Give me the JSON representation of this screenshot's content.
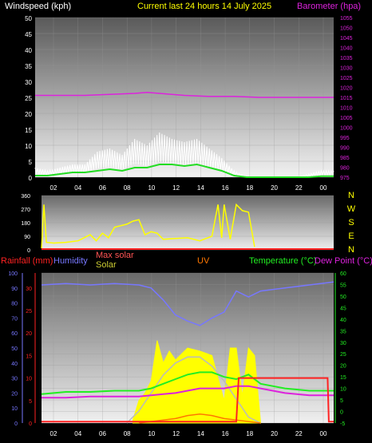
{
  "header": {
    "windspeed_label": "Windspeed (kph)",
    "title": "Current last 24 hours 14 July 2025",
    "barometer_label": "Barometer (hpa)"
  },
  "labels": {
    "rainfall": "Rainfall (mm)",
    "humidity": "Humidity",
    "max_solar": "Max solar",
    "solar": "Solar",
    "uv": "UV",
    "temperature": "Temperature (°C)",
    "dew_point": "Dew Point (°C)"
  },
  "colors": {
    "wind": "#ffffff",
    "wind_avg": "#22dd22",
    "barometer": "#dd22dd",
    "direction": "#ffff00",
    "rainfall": "#ff2222",
    "humidity": "#7777ff",
    "max_solar": "#ff5555",
    "solar": "#ffff00",
    "uv": "#ff7700",
    "temperature": "#22ee22",
    "dew_point": "#dd22dd"
  },
  "chart_data": [
    {
      "type": "line",
      "x_ticks": [
        "02",
        "04",
        "06",
        "08",
        "10",
        "12",
        "14",
        "16",
        "18",
        "20",
        "22",
        "00"
      ],
      "y_left_ticks": [
        0,
        5,
        10,
        15,
        20,
        25,
        30,
        35,
        40,
        45,
        50
      ],
      "y_right_ticks": [
        975,
        980,
        985,
        990,
        995,
        1000,
        1005,
        1010,
        1015,
        1020,
        1025,
        1030,
        1035,
        1040,
        1045,
        1050,
        1055
      ],
      "ylim_left": [
        0,
        50
      ],
      "ylim_right": [
        975,
        1055
      ],
      "series": [
        {
          "name": "Windspeed (kph)",
          "x": [
            0,
            1,
            2,
            3,
            4,
            5,
            6,
            7,
            8,
            9,
            10,
            11,
            12,
            13,
            14,
            15,
            16,
            17,
            18,
            19,
            20,
            21,
            22,
            23,
            24
          ],
          "values": [
            3,
            2,
            3,
            4,
            4,
            8,
            9,
            7,
            12,
            10,
            14,
            12,
            11,
            12,
            9,
            6,
            2,
            0,
            0,
            0,
            0,
            0,
            1,
            2,
            2
          ]
        },
        {
          "name": "Average wind",
          "x": [
            0,
            1,
            2,
            3,
            4,
            5,
            6,
            7,
            8,
            9,
            10,
            11,
            12,
            13,
            14,
            15,
            16,
            17,
            18,
            19,
            20,
            21,
            22,
            23,
            24
          ],
          "values": [
            0.5,
            0.5,
            1,
            1.5,
            1.5,
            2,
            2.5,
            2,
            3,
            3,
            4,
            4,
            3.5,
            4,
            3,
            2,
            0.5,
            0,
            0,
            0,
            0,
            0,
            0,
            0.3,
            0.3
          ]
        },
        {
          "name": "Barometer (hpa)",
          "x": [
            0,
            2,
            4,
            6,
            8,
            9,
            10,
            11,
            12,
            14,
            16,
            18,
            20,
            22,
            24
          ],
          "values": [
            1016,
            1016,
            1016,
            1016.5,
            1017,
            1017.5,
            1017,
            1016.5,
            1016,
            1015.5,
            1015.5,
            1015,
            1015,
            1015,
            1015
          ]
        }
      ]
    },
    {
      "type": "scatter",
      "y_ticks": [
        0,
        90,
        180,
        270,
        360
      ],
      "ylim": [
        0,
        360
      ],
      "compass": [
        "N",
        "W",
        "S",
        "E",
        "N"
      ],
      "series": [
        {
          "name": "Wind direction",
          "x": [
            0,
            0.2,
            0.4,
            1,
            2,
            3,
            4,
            4.5,
            5,
            5.5,
            6,
            6.5,
            7,
            7.5,
            8,
            8.5,
            9,
            9.5,
            10,
            11,
            12,
            13,
            14,
            14.5,
            14.8,
            15,
            15.5,
            16,
            16.5,
            17,
            17.5
          ],
          "values": [
            10,
            300,
            50,
            45,
            50,
            60,
            100,
            60,
            110,
            80,
            150,
            160,
            170,
            190,
            200,
            100,
            120,
            110,
            70,
            75,
            80,
            60,
            90,
            300,
            80,
            300,
            70,
            300,
            260,
            250,
            20
          ]
        }
      ]
    },
    {
      "type": "area",
      "y_left_ticks": [
        0,
        5,
        10,
        15,
        20,
        25,
        30,
        35,
        40,
        45,
        50,
        55,
        60,
        65,
        70,
        75,
        80,
        85,
        90,
        95,
        100
      ],
      "y_right_ticks": [
        -5,
        0,
        5,
        10,
        15,
        20,
        25,
        30,
        35,
        40,
        45,
        50,
        55,
        60
      ],
      "y_rain_ticks": [
        0,
        5,
        10,
        15,
        20,
        25,
        30
      ],
      "ylim_left": [
        0,
        100
      ],
      "ylim_right": [
        -5,
        60
      ],
      "series": [
        {
          "name": "Humidity",
          "x": [
            0,
            2,
            4,
            6,
            8,
            9,
            10,
            11,
            12,
            13,
            14,
            15,
            16,
            17,
            18,
            20,
            22,
            24
          ],
          "values": [
            92,
            93,
            92,
            93,
            92,
            90,
            82,
            72,
            68,
            65,
            70,
            74,
            88,
            84,
            88,
            90,
            92,
            94
          ]
        },
        {
          "name": "Temperature (°C)",
          "x": [
            0,
            2,
            4,
            6,
            8,
            9,
            10,
            11,
            12,
            13,
            14,
            15,
            16,
            17,
            18,
            20,
            22,
            24
          ],
          "values": [
            7.5,
            8.5,
            8.5,
            9,
            9,
            10,
            12,
            14,
            16,
            17,
            17,
            15,
            14,
            16,
            12,
            10,
            9,
            9
          ]
        },
        {
          "name": "Dew Point (°C)",
          "x": [
            0,
            2,
            4,
            6,
            8,
            9,
            10,
            11,
            12,
            13,
            14,
            15,
            16,
            17,
            18,
            20,
            22,
            24
          ],
          "values": [
            6,
            6,
            6.5,
            6.5,
            6.5,
            7,
            7.5,
            8,
            9,
            10,
            10,
            10,
            11,
            11,
            10,
            8,
            7,
            7
          ]
        },
        {
          "name": "Max solar",
          "x": [
            7,
            8,
            9,
            10,
            11,
            12,
            13,
            14,
            15,
            16,
            17,
            18
          ],
          "values": [
            0,
            8,
            20,
            32,
            40,
            44,
            44,
            38,
            28,
            16,
            4,
            0
          ]
        },
        {
          "name": "Solar",
          "x": [
            7.5,
            8,
            8.5,
            9,
            9.5,
            10,
            10.5,
            11,
            12,
            13,
            14,
            15,
            15.5,
            16,
            16.5,
            17,
            17.5,
            18
          ],
          "values": [
            2,
            15,
            20,
            28,
            55,
            40,
            48,
            42,
            50,
            48,
            45,
            15,
            50,
            50,
            18,
            50,
            45,
            0
          ]
        },
        {
          "name": "UV",
          "x": [
            8,
            9,
            10,
            11,
            12,
            13,
            14,
            15,
            16,
            17,
            18
          ],
          "values": [
            0,
            1,
            2,
            3,
            5,
            6,
            5,
            3,
            2,
            1,
            0
          ]
        },
        {
          "name": "Rainfall (mm)",
          "x": [
            0,
            8,
            16,
            16.2,
            23.5,
            23.6,
            24
          ],
          "values": [
            0.3,
            0.3,
            0.3,
            10,
            10,
            0.3,
            0.3
          ]
        }
      ]
    }
  ]
}
